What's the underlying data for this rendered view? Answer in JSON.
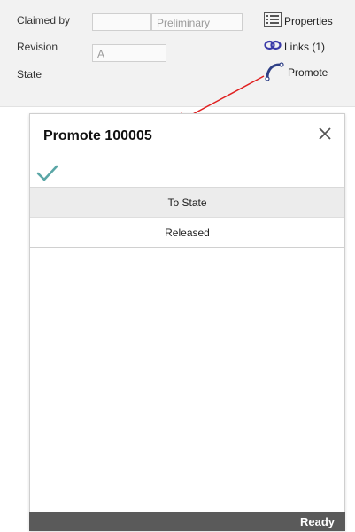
{
  "properties": {
    "claimed_by_label": "Claimed by",
    "claimed_by_value": "",
    "lifecycle_value": "Preliminary",
    "revision_label": "Revision",
    "revision_value": "A",
    "state_label": "State"
  },
  "actions": {
    "properties_label": "Properties",
    "links_label": "Links (1)",
    "promote_label": "Promote"
  },
  "dialog": {
    "title": "Promote 100005",
    "table": {
      "header": "To State",
      "rows": [
        "Released"
      ]
    },
    "status": "Ready"
  },
  "colors": {
    "arrow": "#e02020",
    "check": "#5aa6a6",
    "status_bar": "#5a5a5a",
    "links_icon": "#3a3aa8"
  }
}
